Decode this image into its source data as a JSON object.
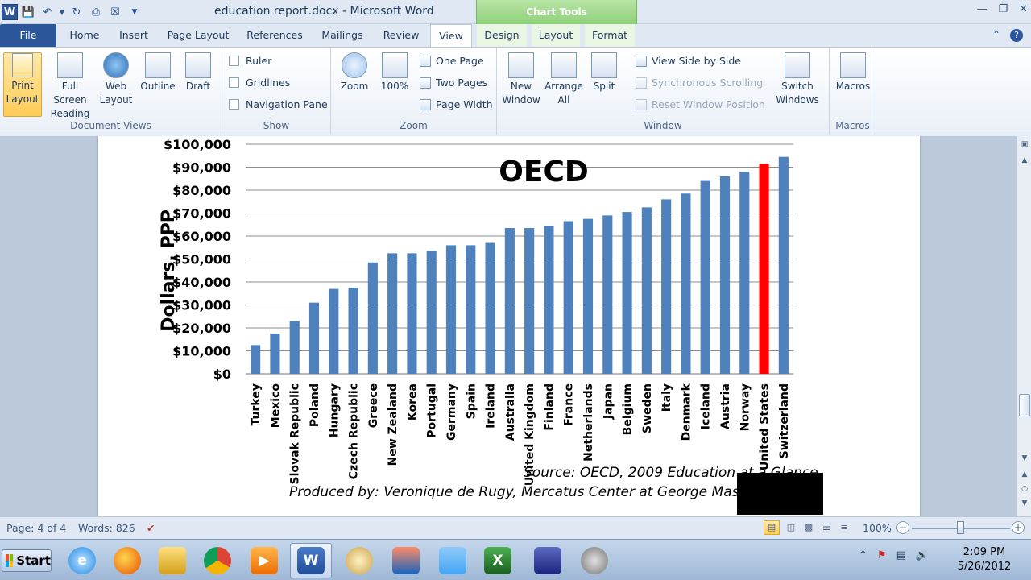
{
  "app": {
    "doc_title": "education report.docx - Microsoft Word",
    "context_tab_group": "Chart Tools"
  },
  "tabs": [
    "File",
    "Home",
    "Insert",
    "Page Layout",
    "References",
    "Mailings",
    "Review",
    "View",
    "Design",
    "Layout",
    "Format"
  ],
  "ribbon": {
    "document_views": {
      "label": "Document Views",
      "buttons": [
        "Print Layout",
        "Full Screen Reading",
        "Web Layout",
        "Outline",
        "Draft"
      ]
    },
    "show": {
      "label": "Show",
      "checks": [
        "Ruler",
        "Gridlines",
        "Navigation Pane"
      ]
    },
    "zoom": {
      "label": "Zoom",
      "big": [
        "Zoom",
        "100%"
      ],
      "small": [
        "One Page",
        "Two Pages",
        "Page Width"
      ]
    },
    "window": {
      "label": "Window",
      "big": [
        "New Window",
        "Arrange All",
        "Split"
      ],
      "small": [
        "View Side by Side",
        "Synchronous Scrolling",
        "Reset Window Position"
      ],
      "switch": "Switch Windows"
    },
    "macros": {
      "label": "Macros",
      "big": "Macros"
    }
  },
  "chart_data": {
    "type": "bar",
    "title": "OECD",
    "ylabel": "Dollars, PPP",
    "ylim": [
      0,
      100000
    ],
    "yticks": [
      "$0",
      "$10,000",
      "$20,000",
      "$30,000",
      "$40,000",
      "$50,000",
      "$60,000",
      "$70,000",
      "$80,000",
      "$90,000",
      "$100,000"
    ],
    "categories": [
      "Turkey",
      "Mexico",
      "Slovak Republic",
      "Poland",
      "Hungary",
      "Czech Republic",
      "Greece",
      "New Zealand",
      "Korea",
      "Portugal",
      "Germany",
      "Spain",
      "Ireland",
      "Australia",
      "United Kingdom",
      "Finland",
      "France",
      "Netherlands",
      "Japan",
      "Belgium",
      "Sweden",
      "Italy",
      "Denmark",
      "Iceland",
      "Austria",
      "Norway",
      "United States",
      "Switzerland"
    ],
    "values": [
      12500,
      17500,
      23000,
      31000,
      37000,
      37500,
      48500,
      52500,
      52500,
      53500,
      56000,
      56000,
      57000,
      63500,
      63500,
      64500,
      66500,
      67500,
      69000,
      70500,
      72500,
      76000,
      78500,
      84000,
      86000,
      88000,
      91500,
      94500
    ],
    "highlight_index": 26,
    "colors": {
      "bar": "#4f81bd",
      "highlight": "#ff0000"
    },
    "grid": true
  },
  "page_text": {
    "source": "Source: OECD, 2009  Education at a Glance",
    "produced": "Produced by: Veronique de Rugy, Mercatus Center at George Mason U"
  },
  "status": {
    "page": "Page: 4 of 4",
    "words": "Words: 826",
    "zoom": "100%"
  },
  "taskbar": {
    "start": "Start",
    "time": "2:09 PM",
    "date": "5/26/2012"
  }
}
